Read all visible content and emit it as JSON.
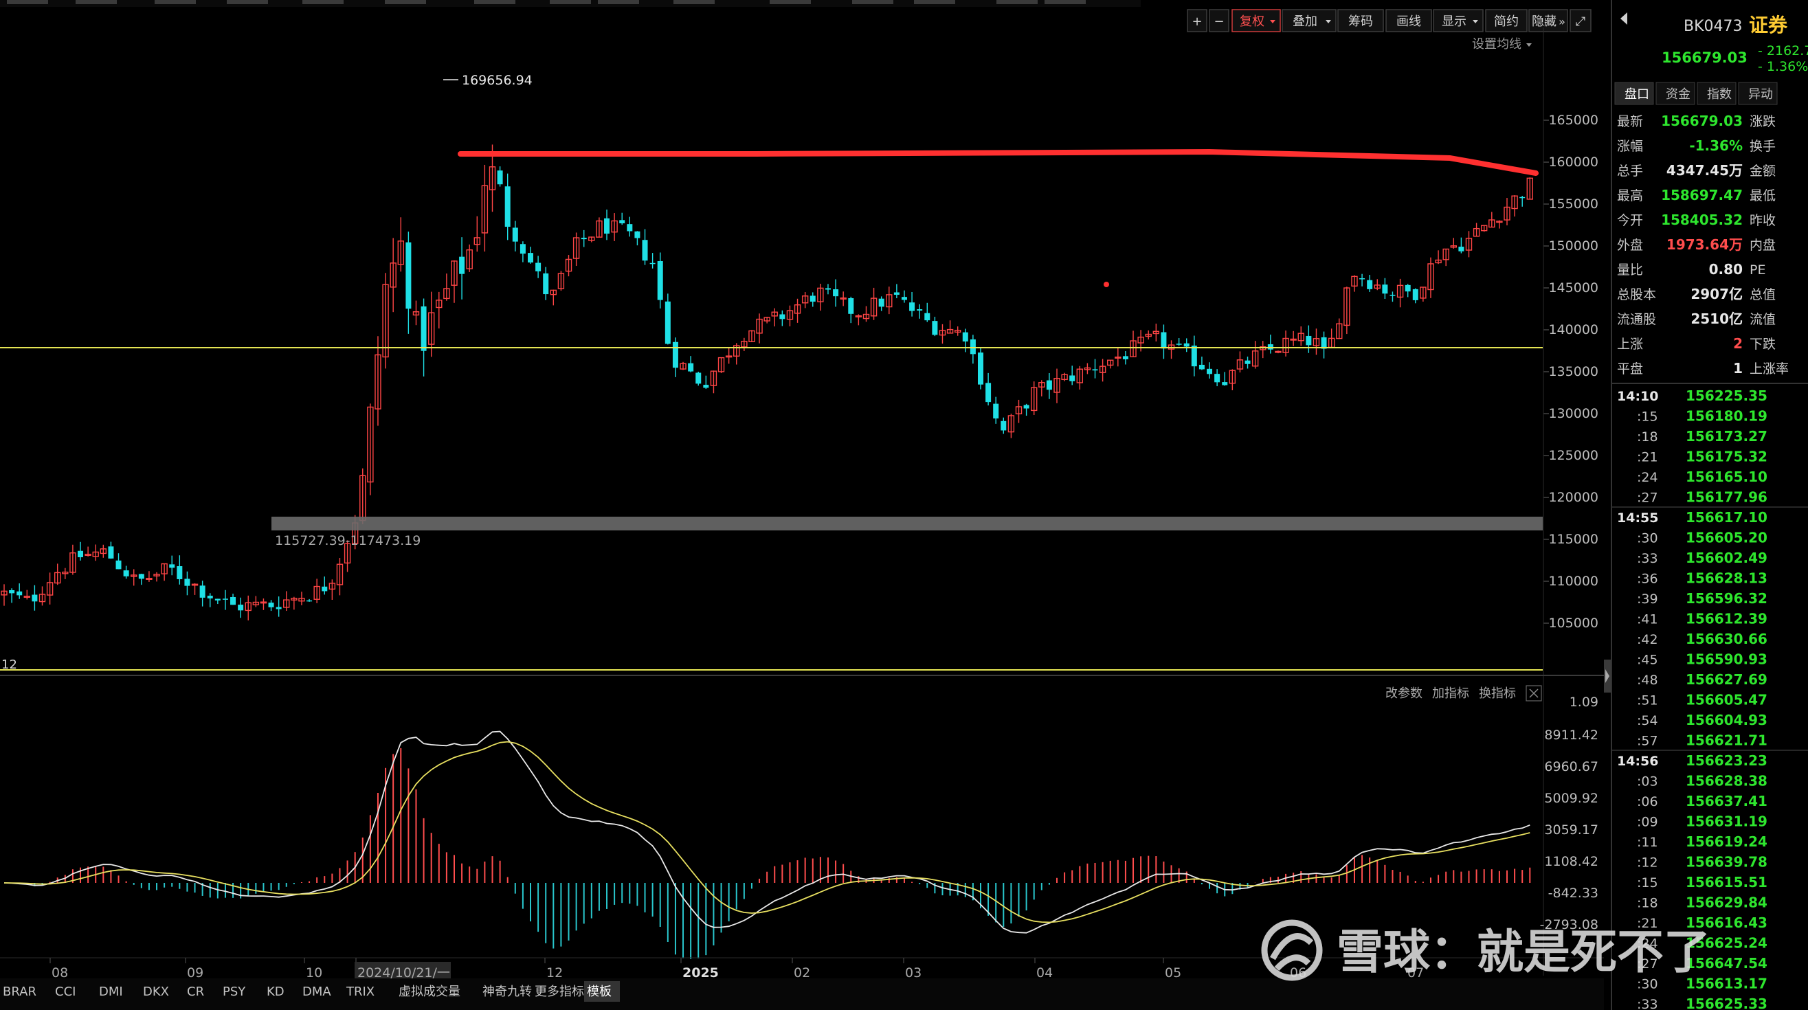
{
  "toolbar": {
    "buttons": [
      "+",
      "−",
      "复权",
      "叠加",
      "筹码",
      "画线",
      "显示",
      "简约",
      "隐藏",
      "⤢"
    ],
    "settings_ma": "设置均线"
  },
  "main_chart": {
    "high_label": "169656.94",
    "zone_label": "115727.39-117473.19",
    "left_edge_label": "12",
    "price_ticks": [
      "165000",
      "160000",
      "155000",
      "150000",
      "145000",
      "140000",
      "135000",
      "130000",
      "125000",
      "120000",
      "115000",
      "110000",
      "105000"
    ]
  },
  "indicator": {
    "buttons": [
      "改参数",
      "加指标",
      "换指标"
    ],
    "ticks": [
      "1.09",
      "8911.42",
      "6960.67",
      "5009.92",
      "3059.17",
      "1108.42",
      "-842.33",
      "-2793.08"
    ]
  },
  "time_axis": {
    "labels": [
      "08",
      "09",
      "10",
      "2024/10/21/一",
      "12",
      "2025",
      "02",
      "03",
      "04",
      "05",
      "06",
      "07"
    ]
  },
  "bottom_tabs": [
    "BRAR",
    "CCI",
    "DMI",
    "DKX",
    "CR",
    "PSY",
    "KD",
    "DMA",
    "TRIX",
    "虚拟成交量",
    "神奇九转",
    "更多指标",
    "模板"
  ],
  "active_tab": "模板",
  "watermark": "雪球：就是死不了",
  "quote": {
    "code": "BK0473",
    "name": "证券",
    "price": "156679.03",
    "change": "- 2162.7",
    "change_pct": "- 1.36%",
    "tabs": [
      "盘口",
      "资金",
      "指数",
      "异动"
    ],
    "rows": [
      {
        "l1": "最新",
        "v1": "156679.03",
        "c1": "#2ee62e",
        "l2": "涨跌"
      },
      {
        "l1": "涨幅",
        "v1": "-1.36%",
        "c1": "#2ee62e",
        "l2": "换手"
      },
      {
        "l1": "总手",
        "v1": "4347.45万",
        "c1": "#e8e8e8",
        "l2": "金额"
      },
      {
        "l1": "最高",
        "v1": "158697.47",
        "c1": "#2ee62e",
        "l2": "最低"
      },
      {
        "l1": "今开",
        "v1": "158405.32",
        "c1": "#2ee62e",
        "l2": "昨收"
      },
      {
        "l1": "外盘",
        "v1": "1973.64万",
        "c1": "#ff4d4d",
        "l2": "内盘"
      },
      {
        "l1": "量比",
        "v1": "0.80",
        "c1": "#e8e8e8",
        "l2": "PE"
      },
      {
        "l1": "总股本",
        "v1": "2907亿",
        "c1": "#e8e8e8",
        "l2": "总值"
      },
      {
        "l1": "流通股",
        "v1": "2510亿",
        "c1": "#e8e8e8",
        "l2": "流值"
      },
      {
        "l1": "上涨",
        "v1": "2",
        "c1": "#ff4d4d",
        "l2": "下跌"
      },
      {
        "l1": "平盘",
        "v1": "1",
        "c1": "#e8e8e8",
        "l2": "上涨率"
      }
    ],
    "ticks": [
      {
        "t": "14:10",
        "p": "156225.35",
        "head": true
      },
      {
        "t": ":15",
        "p": "156180.19"
      },
      {
        "t": ":18",
        "p": "156173.27"
      },
      {
        "t": ":21",
        "p": "156175.32"
      },
      {
        "t": ":24",
        "p": "156165.10"
      },
      {
        "t": ":27",
        "p": "156177.96"
      },
      {
        "t": "14:55",
        "p": "156617.10",
        "head": true
      },
      {
        "t": ":30",
        "p": "156605.20"
      },
      {
        "t": ":33",
        "p": "156602.49"
      },
      {
        "t": ":36",
        "p": "156628.13"
      },
      {
        "t": ":39",
        "p": "156596.32"
      },
      {
        "t": ":41",
        "p": "156612.39"
      },
      {
        "t": ":42",
        "p": "156630.66"
      },
      {
        "t": ":45",
        "p": "156590.93"
      },
      {
        "t": ":48",
        "p": "156627.69"
      },
      {
        "t": ":51",
        "p": "156605.47"
      },
      {
        "t": ":54",
        "p": "156604.93"
      },
      {
        "t": ":57",
        "p": "156621.71"
      },
      {
        "t": "14:56",
        "p": "156623.23",
        "head": true
      },
      {
        "t": ":03",
        "p": "156628.38"
      },
      {
        "t": ":06",
        "p": "156637.41"
      },
      {
        "t": ":09",
        "p": "156631.19"
      },
      {
        "t": ":11",
        "p": "156619.24"
      },
      {
        "t": ":12",
        "p": "156639.78"
      },
      {
        "t": ":15",
        "p": "156615.51"
      },
      {
        "t": ":18",
        "p": "156629.84"
      },
      {
        "t": ":21",
        "p": "156616.43"
      },
      {
        "t": ":24",
        "p": "156625.24"
      },
      {
        "t": ":27",
        "p": "156647.54"
      },
      {
        "t": ":30",
        "p": "156613.17"
      },
      {
        "t": ":33",
        "p": "156625.33"
      }
    ]
  },
  "colors": {
    "up": "#ff4545",
    "down": "#1fe0e6",
    "ma": "#e8e8e8",
    "signal": "#e8e060",
    "level_line": "#e6e654",
    "red_line": "#ff3030",
    "price_green": "#2ee62e"
  }
}
